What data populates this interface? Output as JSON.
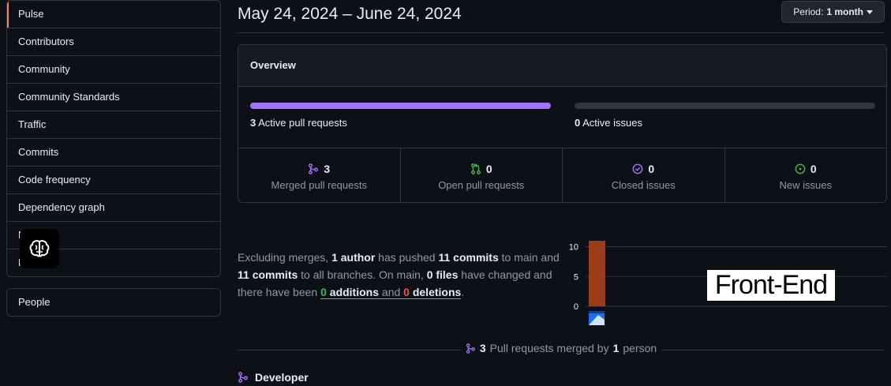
{
  "sidebar": {
    "items": [
      {
        "label": "Pulse",
        "active": true
      },
      {
        "label": "Contributors"
      },
      {
        "label": "Community"
      },
      {
        "label": "Community Standards"
      },
      {
        "label": "Traffic"
      },
      {
        "label": "Commits"
      },
      {
        "label": "Code frequency"
      },
      {
        "label": "Dependency graph"
      },
      {
        "label": "N"
      },
      {
        "label": "F"
      }
    ],
    "secondary": {
      "label": "People"
    }
  },
  "header": {
    "date_range": "May 24, 2024 – June 24, 2024",
    "period_label": "Period:",
    "period_value": "1 month"
  },
  "overview": {
    "title": "Overview",
    "active_prs": {
      "count": "3",
      "label": "Active pull requests",
      "fill_fraction": 1.0
    },
    "active_issues": {
      "count": "0",
      "label": "Active issues",
      "fill_fraction": 0.0
    },
    "stats": [
      {
        "icon": "git-merge-icon",
        "color": "#a371f7",
        "value": "3",
        "label": "Merged pull requests"
      },
      {
        "icon": "git-pull-request-icon",
        "color": "#3fb950",
        "value": "0",
        "label": "Open pull requests"
      },
      {
        "icon": "issue-closed-icon",
        "color": "#a371f7",
        "value": "0",
        "label": "Closed issues"
      },
      {
        "icon": "issue-opened-icon",
        "color": "#3fb950",
        "value": "0",
        "label": "New issues"
      }
    ]
  },
  "summary": {
    "t1": "Excluding merges, ",
    "author_count": "1 author",
    "t2": " has pushed ",
    "commits_main": "11 commits",
    "t3": " to main and ",
    "commits_all": "11 commits",
    "t4": " to all branches. On main, ",
    "files": "0 files",
    "t5": " have changed and there have been ",
    "additions_num": "0",
    "additions_word": "additions",
    "t6": " and ",
    "deletions_num": "0",
    "deletions_word": "deletions",
    "t7": "."
  },
  "chart_data": {
    "type": "bar",
    "categories": [
      "contributor"
    ],
    "values": [
      11
    ],
    "ylim": [
      0,
      11
    ],
    "yticks": [
      "10",
      "5",
      "0"
    ],
    "bar_color": "#9a3d1a",
    "grid": true
  },
  "overlay_label": "Front-End",
  "merged": {
    "count": "3",
    "text": "Pull requests merged by",
    "people": "1",
    "people_word": "person"
  },
  "developer": {
    "label": "Developer"
  }
}
